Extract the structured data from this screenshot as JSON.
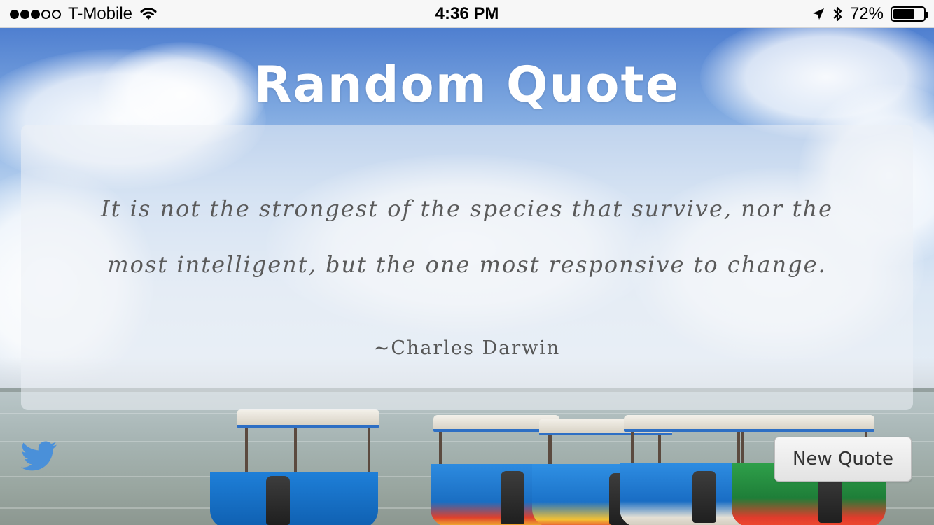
{
  "status_bar": {
    "carrier": "T-Mobile",
    "signal_bars_filled": 3,
    "signal_bars_total": 5,
    "time": "4:36 PM",
    "battery_percent_label": "72%",
    "battery_level": 0.72,
    "icons": [
      "wifi-icon",
      "location-arrow-icon",
      "bluetooth-icon",
      "battery-icon"
    ]
  },
  "app": {
    "title": "Random Quote"
  },
  "quote": {
    "text": "It is not the strongest of the species that survive, nor the most intelligent, but the one most responsive to change.",
    "author": "~Charles Darwin"
  },
  "actions": {
    "tweet_icon": "twitter-bird-icon",
    "new_quote_label": "New Quote"
  },
  "colors": {
    "twitter_blue": "#4a90d9",
    "title_text": "#ffffff",
    "quote_text": "#5a5a5a"
  }
}
